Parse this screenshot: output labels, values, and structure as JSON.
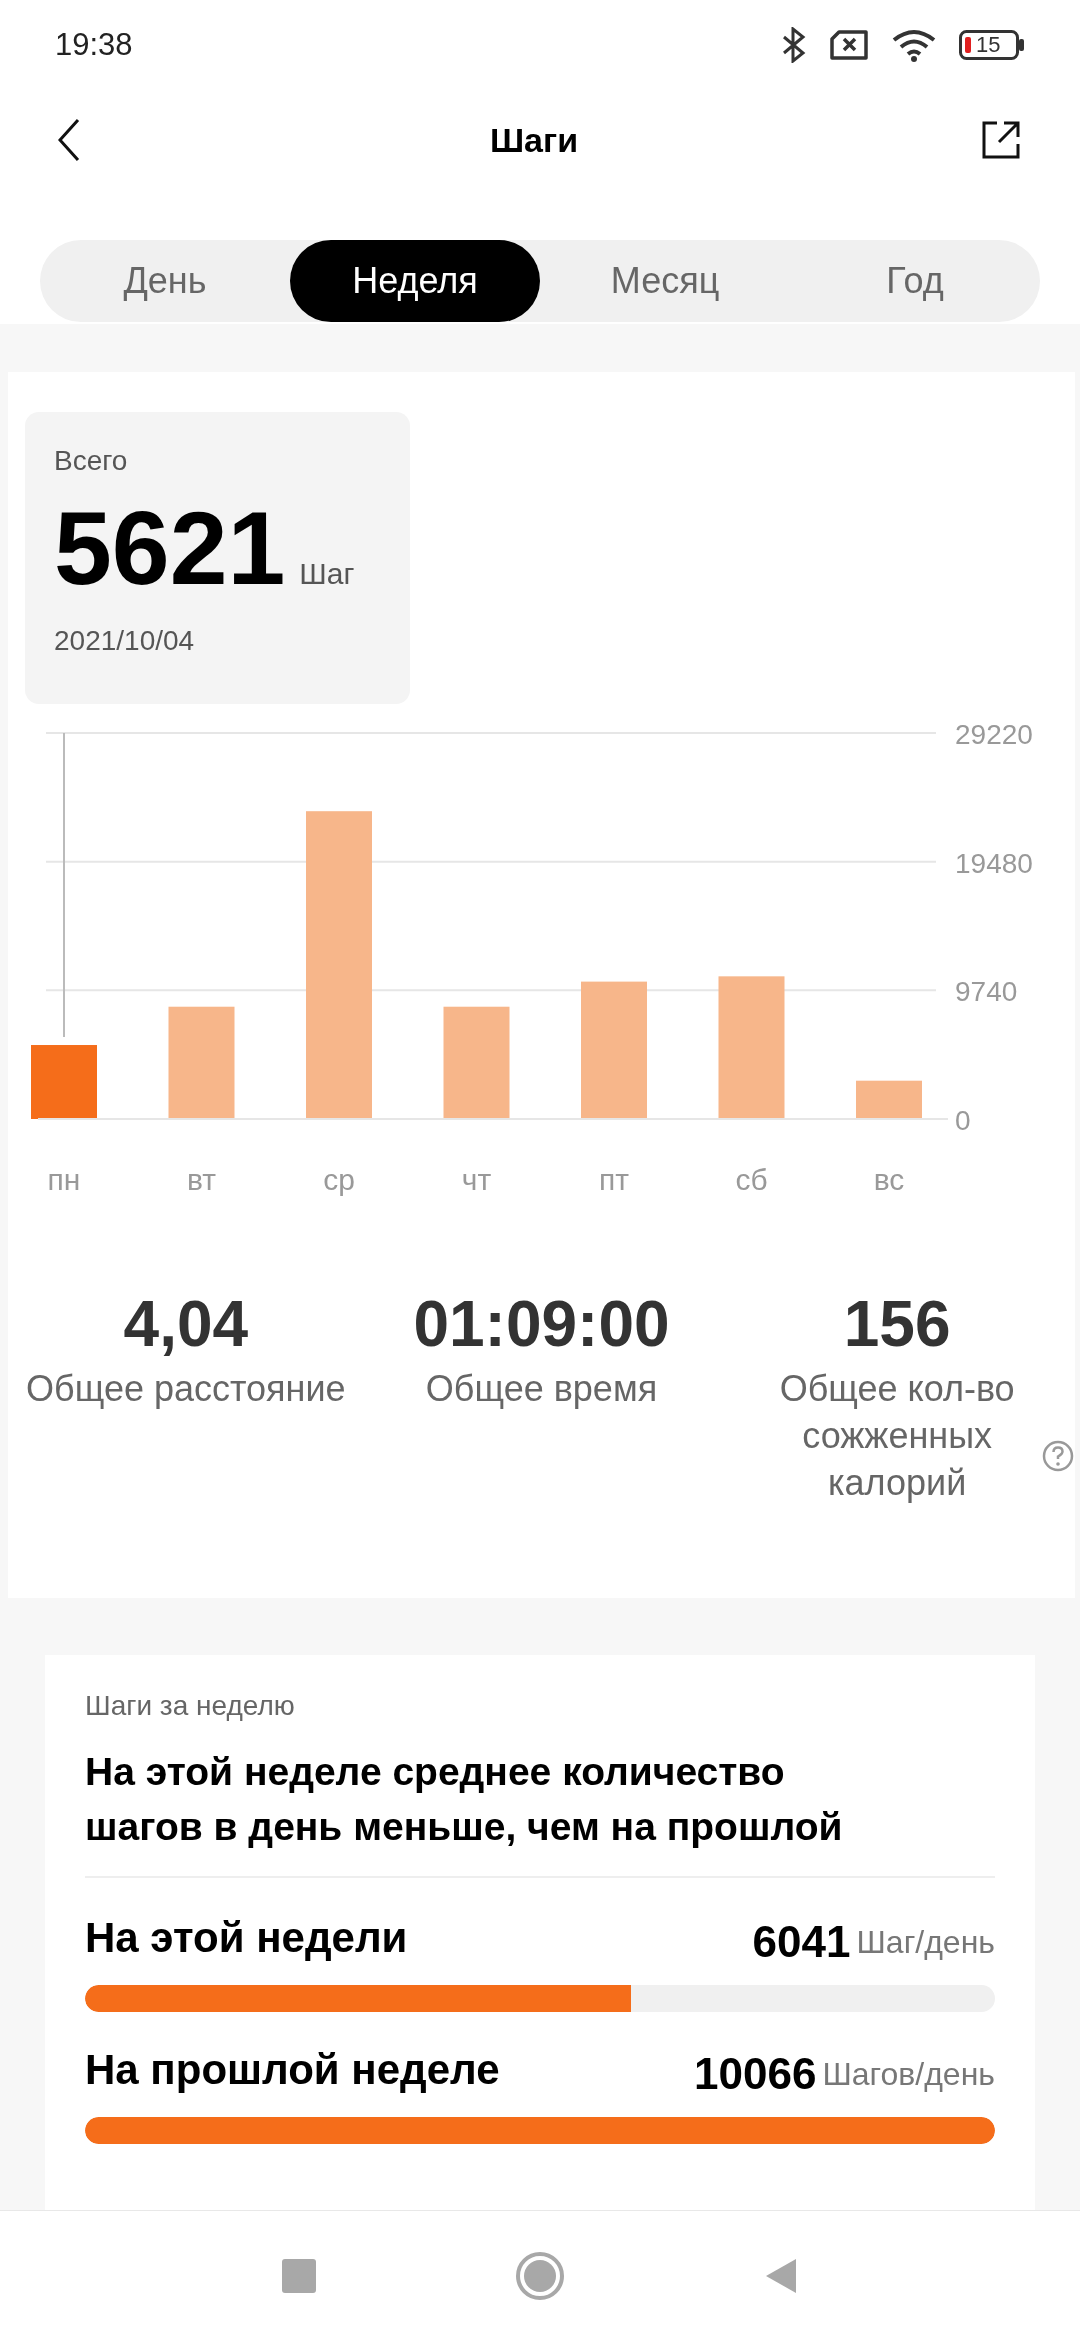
{
  "status_bar": {
    "time": "19:38",
    "battery": "15"
  },
  "header": {
    "title": "Шаги"
  },
  "tabs": [
    {
      "label": "День",
      "selected": false
    },
    {
      "label": "Неделя",
      "selected": true
    },
    {
      "label": "Месяц",
      "selected": false
    },
    {
      "label": "Год",
      "selected": false
    }
  ],
  "summary": {
    "label": "Всего",
    "value": "5621",
    "unit": "Шаг",
    "date": "2021/10/04"
  },
  "chart": {
    "bars": [
      {
        "selected": true
      },
      {
        "selected": false
      },
      {
        "selected": false
      },
      {
        "selected": false
      },
      {
        "selected": false
      },
      {
        "selected": false
      },
      {
        "selected": false
      }
    ],
    "chart_data": {
      "type": "bar",
      "categories": [
        "пн",
        "вт",
        "ср",
        "чт",
        "пт",
        "сб",
        "вс"
      ],
      "values": [
        5600,
        8500,
        23300,
        8500,
        10400,
        10800,
        2900
      ],
      "ylim": [
        0,
        29220
      ],
      "yticks": [
        0,
        9740,
        19480,
        29220
      ]
    }
  },
  "stats": [
    {
      "value": "4,04",
      "label": "Общее расстояние",
      "help": false
    },
    {
      "value": "01:09:00",
      "label": "Общее время",
      "help": false
    },
    {
      "value": "156",
      "label": "Общее кол-во сожженных калорий",
      "help": true
    }
  ],
  "week_card": {
    "subtitle": "Шаги за неделю",
    "headline": "На этой неделе среднее количество шагов в день меньше, чем на прошлой",
    "rows": [
      {
        "label": "На этой недели",
        "value": "6041",
        "unit": "Шаг/день",
        "level": 0.6
      },
      {
        "label": "На прошлой неделе",
        "value": "10066",
        "unit": "Шагов/день",
        "level": 1.0
      }
    ]
  }
}
